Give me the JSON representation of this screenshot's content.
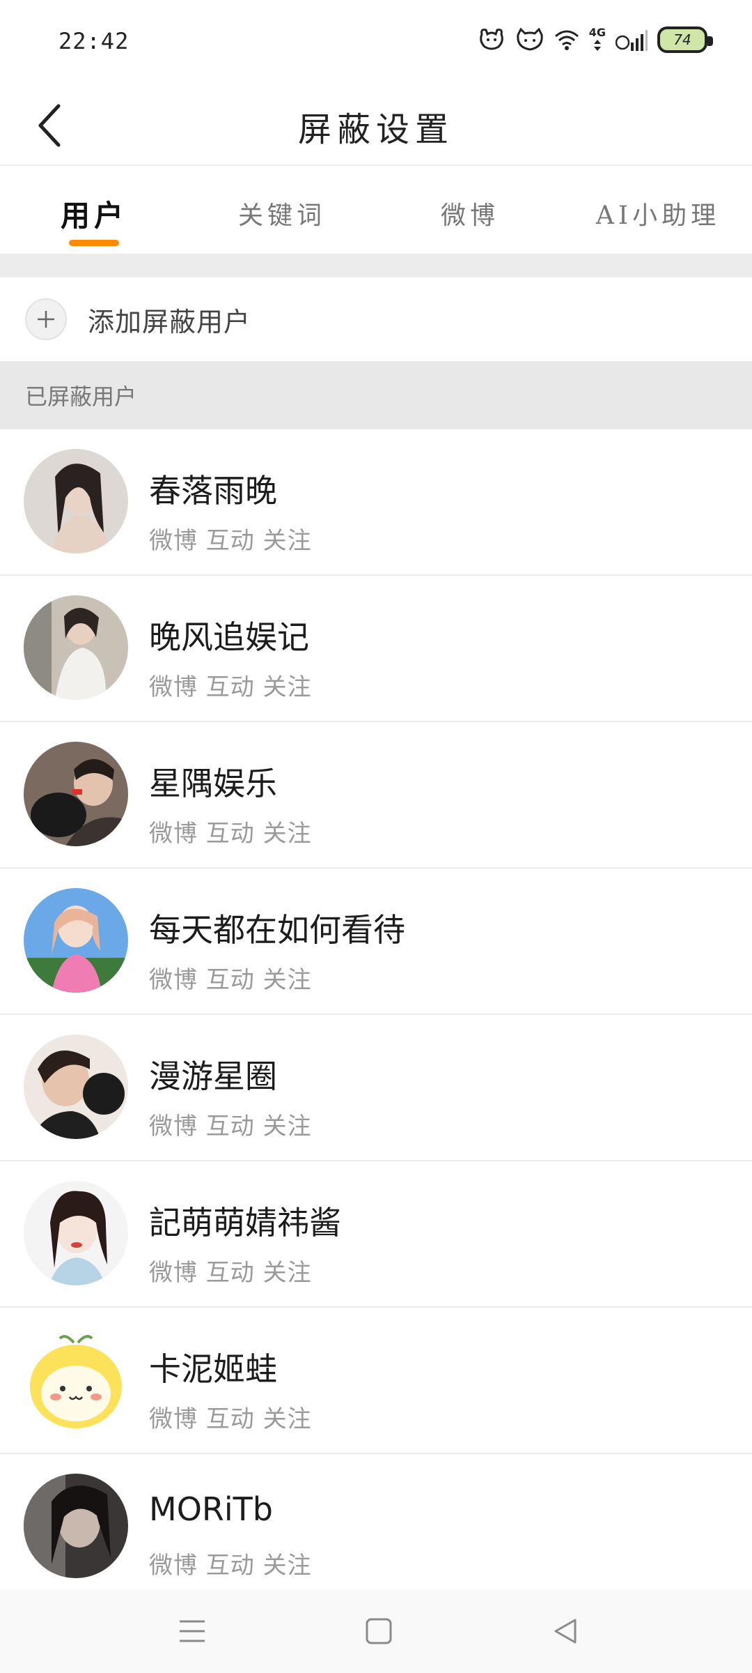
{
  "status_bar": {
    "time": "22:42",
    "network": "4G",
    "battery": "74",
    "icons": [
      "notification-dog-icon",
      "notification-cat-icon",
      "wifi-icon",
      "signal-icon",
      "battery-icon"
    ]
  },
  "header": {
    "title": "屏蔽设置",
    "back_icon": "chevron-left-icon"
  },
  "tabs": [
    {
      "label": "用户",
      "active": true
    },
    {
      "label": "关键词",
      "active": false
    },
    {
      "label": "微博",
      "active": false
    },
    {
      "label": "AI小助理",
      "active": false
    }
  ],
  "accent_color": "#ff8a00",
  "add_row": {
    "icon": "plus-icon",
    "label": "添加屏蔽用户"
  },
  "section": {
    "title": "已屏蔽用户"
  },
  "users": [
    {
      "name": "春落雨晚",
      "tags": "微博 互动 关注"
    },
    {
      "name": "晚风追娱记",
      "tags": "微博 互动 关注"
    },
    {
      "name": "星隅娱乐",
      "tags": "微博 互动 关注"
    },
    {
      "name": "每天都在如何看待",
      "tags": "微博 互动 关注"
    },
    {
      "name": "漫游星圈",
      "tags": "微博 互动 关注"
    },
    {
      "name": "記萌萌婧祎酱",
      "tags": "微博 互动 关注"
    },
    {
      "name": "卡泥姬蛙",
      "tags": "微博 互动 关注"
    },
    {
      "name": "MORiTb",
      "tags": "微博 互动 关注"
    }
  ],
  "nav_bar": {
    "icons": [
      "menu-icon",
      "home-square-icon",
      "back-triangle-icon"
    ]
  }
}
